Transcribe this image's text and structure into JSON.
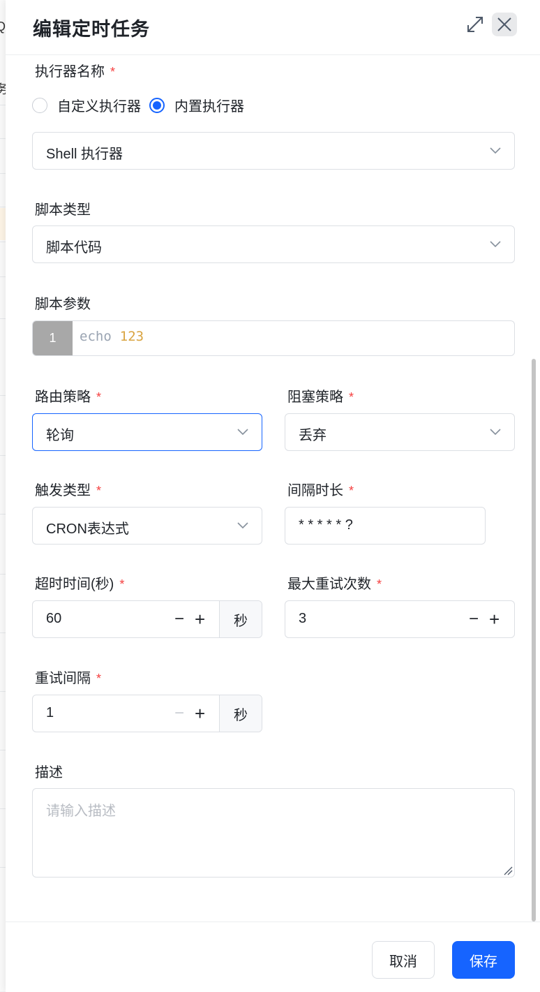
{
  "background": {
    "glyph_top": "Q",
    "glyph_mid": "务"
  },
  "drawer": {
    "title": "编辑定时任务"
  },
  "form": {
    "executor_name": {
      "label": "执行器名称",
      "required_mark": "*",
      "radio_options": [
        {
          "label": "自定义执行器",
          "checked": false
        },
        {
          "label": "内置执行器",
          "checked": true
        }
      ],
      "select_value": "Shell 执行器"
    },
    "script_type": {
      "label": "脚本类型",
      "select_value": "脚本代码"
    },
    "script_params": {
      "label": "脚本参数",
      "line_number": "1",
      "code_keyword": "echo",
      "code_number": "123"
    },
    "route_strategy": {
      "label": "路由策略",
      "required_mark": "*",
      "select_value": "轮询"
    },
    "block_strategy": {
      "label": "阻塞策略",
      "required_mark": "*",
      "select_value": "丢弃"
    },
    "trigger_type": {
      "label": "触发类型",
      "required_mark": "*",
      "select_value": "CRON表达式"
    },
    "interval": {
      "label": "间隔时长",
      "required_mark": "*",
      "value": "* * * * * ?"
    },
    "timeout": {
      "label": "超时时间(秒)",
      "required_mark": "*",
      "value": "60",
      "minus": "−",
      "plus": "+",
      "suffix": "秒"
    },
    "max_retry": {
      "label": "最大重试次数",
      "required_mark": "*",
      "value": "3",
      "minus": "−",
      "plus": "+"
    },
    "retry_interval": {
      "label": "重试间隔",
      "required_mark": "*",
      "value": "1",
      "minus": "−",
      "plus": "+",
      "suffix": "秒"
    },
    "description": {
      "label": "描述",
      "placeholder": "请输入描述"
    }
  },
  "footer": {
    "cancel_label": "取消",
    "save_label": "保存"
  },
  "colors": {
    "primary": "#1664ff",
    "required": "#f53f3f",
    "code_keyword": "#9aa4b2",
    "code_number": "#d9a441"
  }
}
